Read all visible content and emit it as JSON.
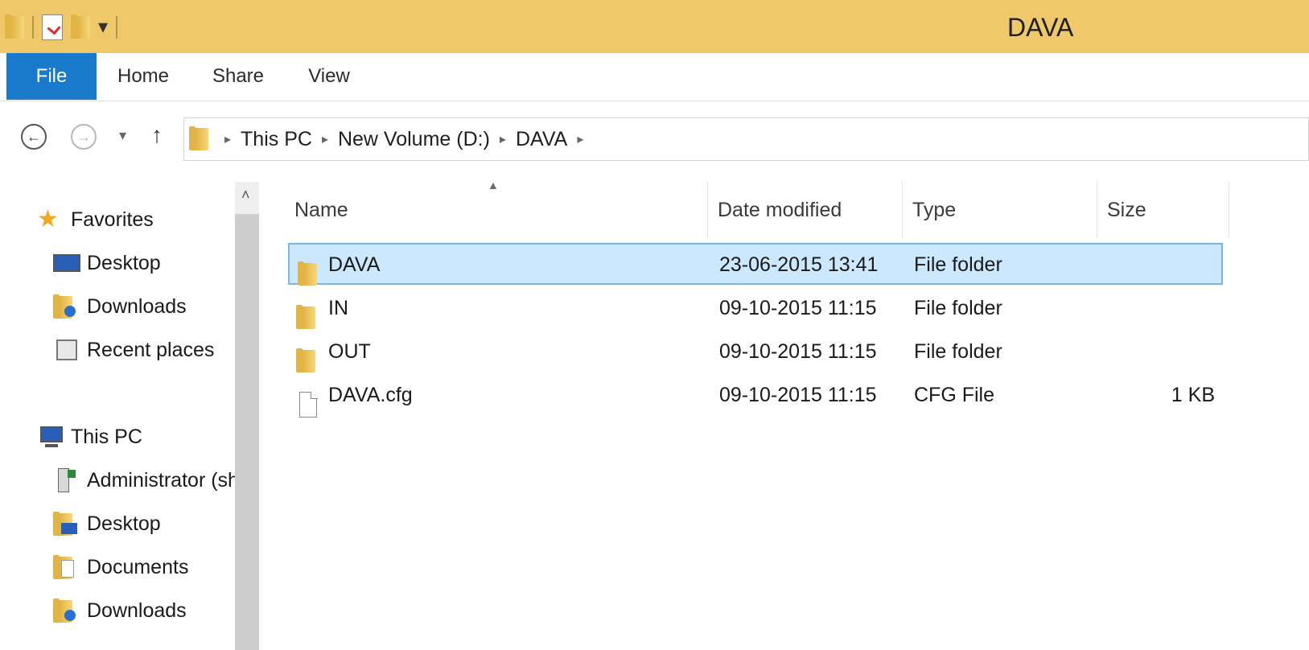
{
  "window": {
    "title": "DAVA"
  },
  "ribbon": {
    "tabs": [
      "File",
      "Home",
      "Share",
      "View"
    ]
  },
  "address": {
    "crumbs": [
      "This PC",
      "New Volume (D:)",
      "DAVA"
    ]
  },
  "nav_pane": {
    "favorites_header": "Favorites",
    "favorites": [
      "Desktop",
      "Downloads",
      "Recent places"
    ],
    "this_pc_header": "This PC",
    "this_pc_items": [
      "Administrator (sh",
      "Desktop",
      "Documents",
      "Downloads"
    ]
  },
  "columns": {
    "name": "Name",
    "date": "Date modified",
    "type": "Type",
    "size": "Size"
  },
  "files": [
    {
      "name": "DAVA",
      "date": "23-06-2015 13:41",
      "type": "File folder",
      "size": "",
      "icon": "folder-icon",
      "selected": true
    },
    {
      "name": "IN",
      "date": "09-10-2015 11:15",
      "type": "File folder",
      "size": "",
      "icon": "folder-icon",
      "selected": false
    },
    {
      "name": "OUT",
      "date": "09-10-2015 11:15",
      "type": "File folder",
      "size": "",
      "icon": "folder-icon",
      "selected": false
    },
    {
      "name": "DAVA.cfg",
      "date": "09-10-2015 11:15",
      "type": "CFG File",
      "size": "1 KB",
      "icon": "file-icon",
      "selected": false
    }
  ],
  "colors": {
    "titlebar": "#efc86a",
    "file_tab": "#1979ca",
    "selection": "#cce8ff",
    "selection_border": "#7ab8e8"
  }
}
